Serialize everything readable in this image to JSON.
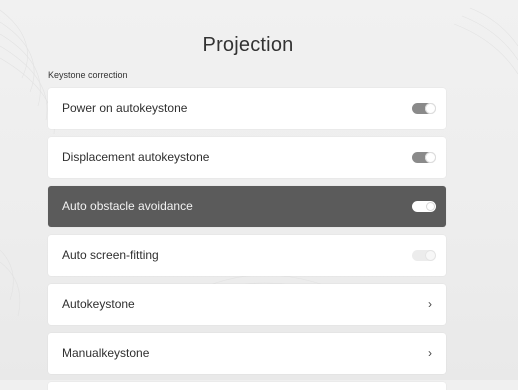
{
  "page": {
    "title": "Projection",
    "section_label": "Keystone correction"
  },
  "settings": [
    {
      "label": "Power on autokeystone",
      "control": "toggle",
      "state": "on",
      "focused": false
    },
    {
      "label": "Displacement autokeystone",
      "control": "toggle",
      "state": "on",
      "focused": false
    },
    {
      "label": "Auto obstacle avoidance",
      "control": "toggle",
      "state": "on",
      "focused": true
    },
    {
      "label": "Auto screen-fitting",
      "control": "toggle",
      "state": "off",
      "focused": false
    },
    {
      "label": "Autokeystone",
      "control": "chevron",
      "chevron": "›",
      "focused": false
    },
    {
      "label": "Manualkeystone",
      "control": "chevron",
      "chevron": "›",
      "focused": false
    }
  ],
  "icons": {
    "chevron": "chevron-right-icon",
    "toggle": "toggle-switch-icon"
  },
  "colors": {
    "background": "#efefef",
    "card": "#ffffff",
    "focused_card": "#5b5b5b",
    "toggle_on": "#8a8a8a",
    "toggle_off": "#ececec"
  }
}
